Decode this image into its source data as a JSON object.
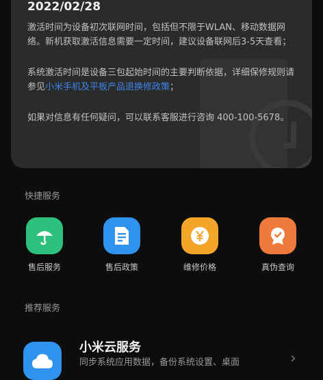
{
  "activation": {
    "date": "2022/02/28",
    "para1": "激活时间为设备初次联网时间，包括但不限于WLAN、移动数据网络。新机获取激活信息需要一定时间，建议设备联网后3-5天查看；",
    "para2_prefix": "系统激活时间是设备三包起始时间的主要判断依据，详细保修规则请参见",
    "para2_link": "小米手机及平板产品退换修政策",
    "para2_suffix": "；",
    "para3": "如果对信息有任何疑问，可以联系客服进行咨询 400-100-5678。"
  },
  "quick_services": {
    "title": "快捷服务",
    "items": [
      {
        "label": "售后服务",
        "icon": "umbrella-icon",
        "color": "#2cc27e"
      },
      {
        "label": "售后政策",
        "icon": "document-icon",
        "color": "#2f92ec"
      },
      {
        "label": "维修价格",
        "icon": "yen-coin-icon",
        "color": "#f3a52a"
      },
      {
        "label": "真伪查询",
        "icon": "verified-badge-icon",
        "color": "#f07a3c"
      }
    ]
  },
  "recommended": {
    "title": "推荐服务",
    "item": {
      "title": "小米云服务",
      "desc": "同步系统应用数据，备份系统设置、桌面",
      "icon": "cloud-icon"
    }
  }
}
